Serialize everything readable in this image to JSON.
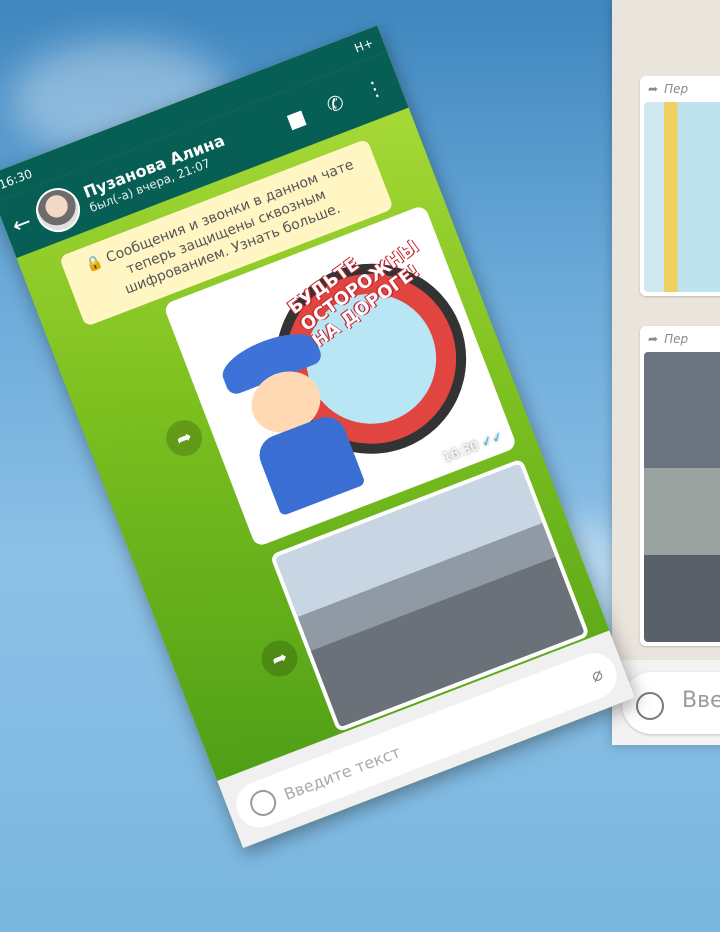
{
  "status": {
    "time": "16:30",
    "network": "H+"
  },
  "header": {
    "contact_name": "Пузанова Алина",
    "last_seen": "был(-а) вчера, 21:07"
  },
  "notice": "🔒 Сообщения и звонки в данном чате теперь защищены сквозным шифрованием. Узнать больше.",
  "sticker": {
    "slogan": "БУДЬТЕ ОСТОРОЖНЫ НА ДОРОГЕ!",
    "time": "16:30"
  },
  "input": {
    "placeholder": "Введите текст"
  },
  "second_phone": {
    "forwarded_label": "Пер",
    "input_placeholder": "Вве"
  },
  "colors": {
    "header": "#075e54",
    "chat_bg": "#8ac42a",
    "notice_bg": "#fff6c4"
  },
  "icons": [
    "back-arrow-icon",
    "video-call-icon",
    "phone-call-icon",
    "more-icon",
    "share-icon",
    "emoji-icon",
    "attach-icon"
  ]
}
